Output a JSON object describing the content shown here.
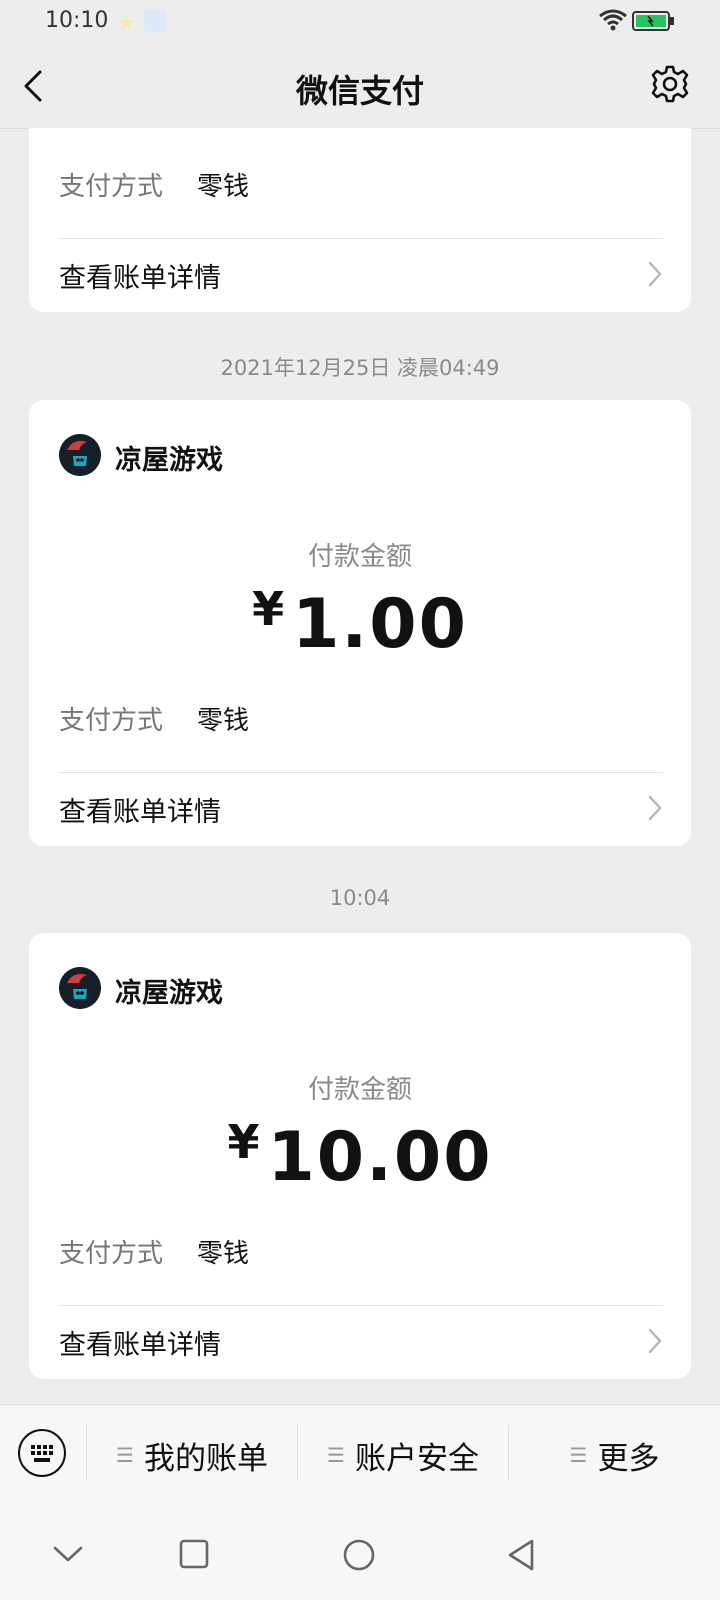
{
  "status_bar": {
    "time": "10:10",
    "wifi_icon": "wifi-icon",
    "battery_icon": "battery-icon",
    "battery_color": "#22c55e"
  },
  "nav": {
    "title": "微信支付",
    "back_icon": "back-arrow-icon",
    "settings_icon": "gear-icon"
  },
  "cards": [
    {
      "pay_method_label": "支付方式",
      "pay_method_value": "零钱",
      "detail_label": "查看账单详情"
    },
    {
      "timestamp": "2021年12月25日 凌晨04:49",
      "merchant": "凉屋游戏",
      "amount_label": "付款金额",
      "currency": "¥",
      "amount": "1.00",
      "pay_method_label": "支付方式",
      "pay_method_value": "零钱",
      "detail_label": "查看账单详情"
    },
    {
      "timestamp": "10:04",
      "merchant": "凉屋游戏",
      "amount_label": "付款金额",
      "currency": "¥",
      "amount": "10.00",
      "pay_method_label": "支付方式",
      "pay_method_value": "零钱",
      "detail_label": "查看账单详情"
    }
  ],
  "bottom_menu": {
    "keyboard_icon": "keyboard-icon",
    "items": [
      {
        "label": "我的账单"
      },
      {
        "label": "账户安全"
      },
      {
        "label": "更多"
      }
    ]
  },
  "system_nav": {
    "icons": [
      "chevron-down-icon",
      "recents-icon",
      "home-icon",
      "back-triangle-icon"
    ]
  },
  "colors": {
    "background": "#ededed",
    "card": "#ffffff",
    "text_primary": "#111111",
    "text_secondary": "#8a8a8a"
  }
}
